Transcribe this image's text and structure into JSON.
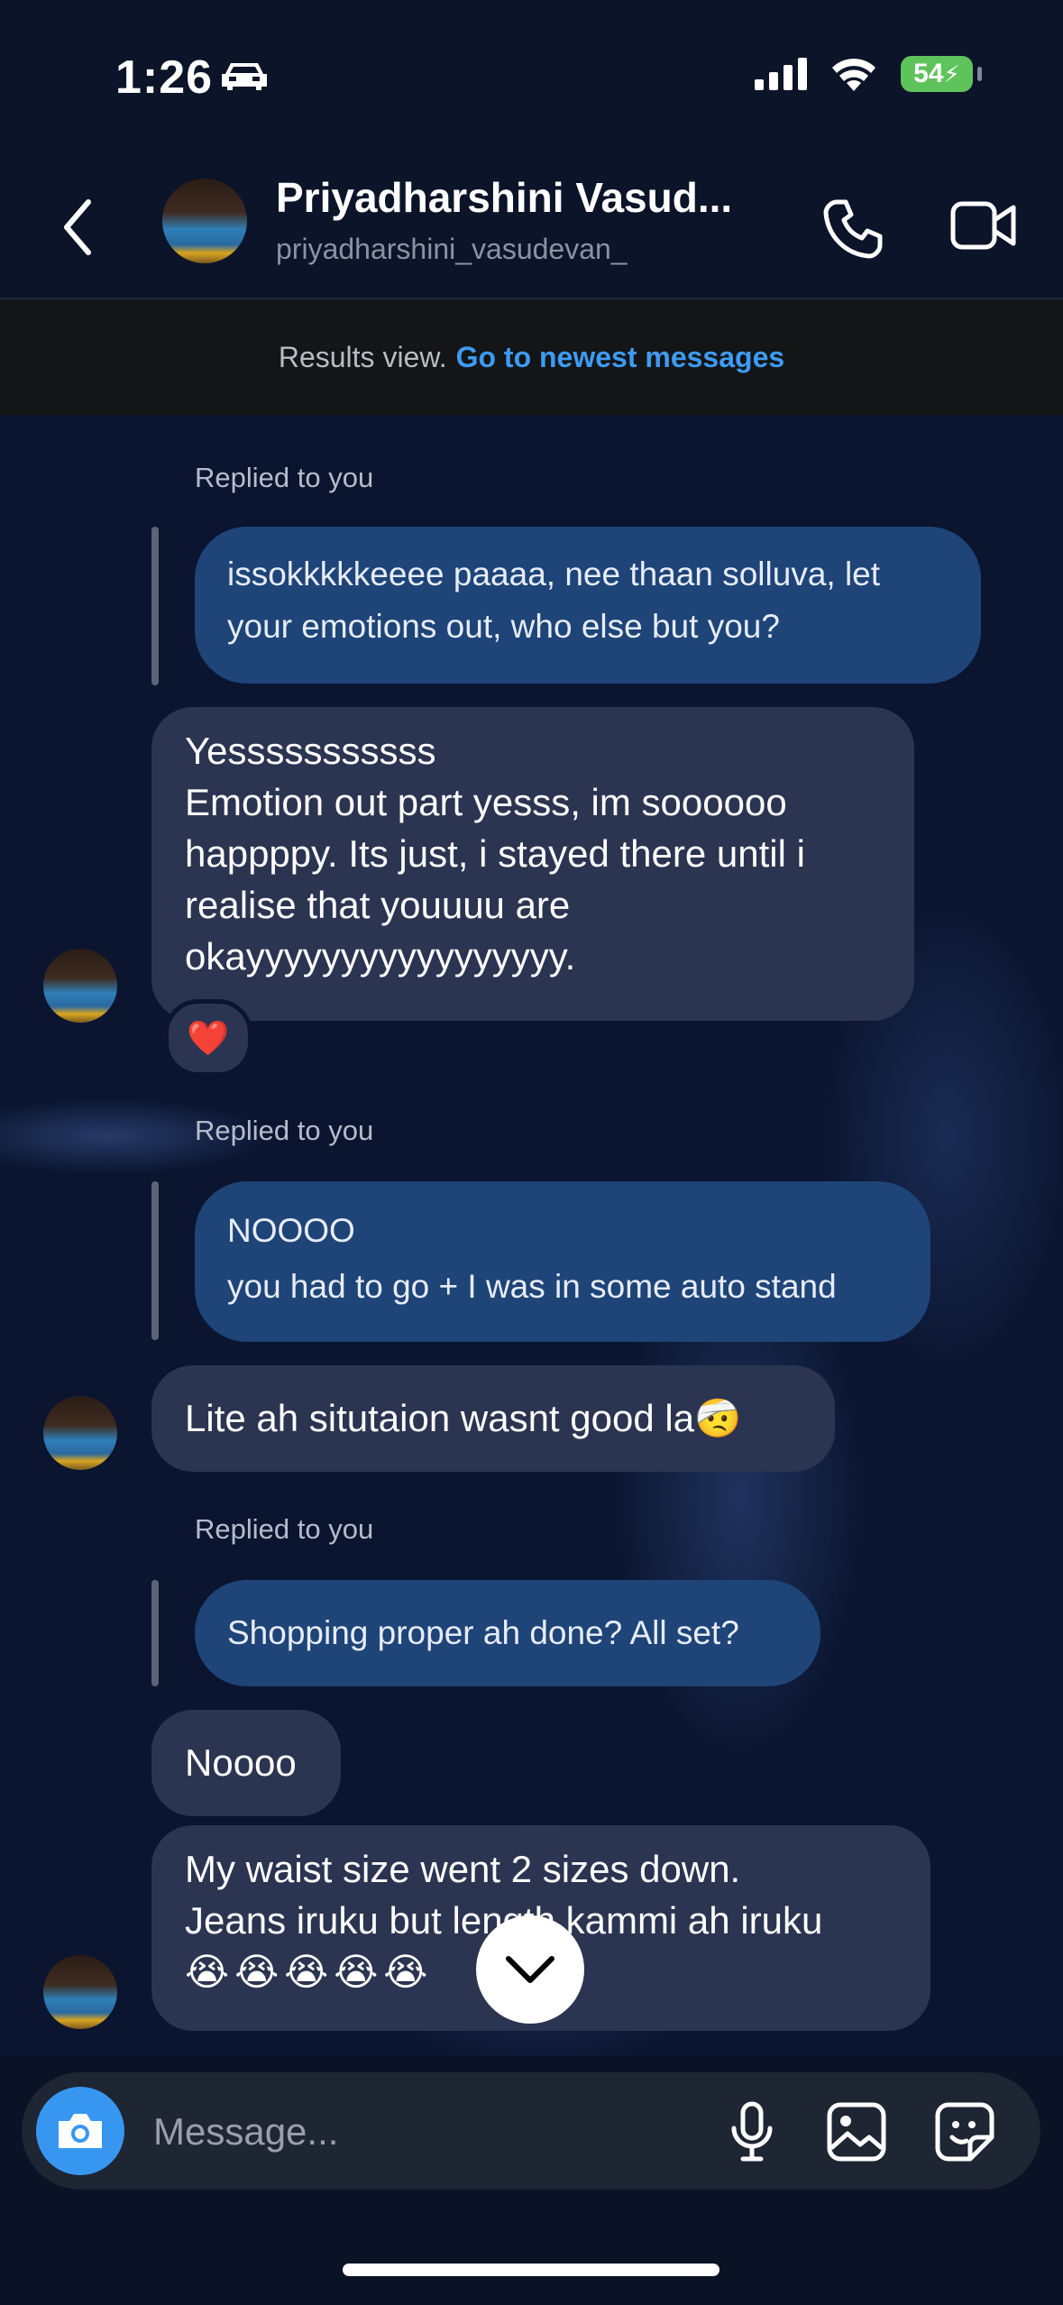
{
  "status": {
    "time": "1:26",
    "battery": "54"
  },
  "header": {
    "name": "Priyadharshini Vasud...",
    "handle": "priyadharshini_vasudevan_"
  },
  "results_bar": {
    "text": "Results view.",
    "link": "Go to newest messages"
  },
  "messages": [
    {
      "replied_label": "Replied to you",
      "lines": [
        "issokkkkkeeee paaaa, nee thaan solluva, let",
        "your emotions out, who else but you?"
      ]
    },
    {
      "lines": [
        "Yesssssssssss",
        "Emotion out part yesss, im soooooo",
        "happppy. Its just, i stayed there until i",
        "realise that youuuu are",
        "okayyyyyyyyyyyyyyyyy."
      ],
      "reaction": "❤️"
    },
    {
      "replied_label": "Replied to you",
      "lines": [
        "NOOOO",
        "you had to go + I was in some auto stand"
      ]
    },
    {
      "text": "Lite ah situtaion wasnt good la",
      "emoji": "🤕"
    },
    {
      "replied_label": "Replied to you",
      "text": "Shopping proper ah done? All set?"
    },
    {
      "text": "Noooo"
    },
    {
      "lines": [
        "My waist size went 2 sizes down.",
        "Jeans iruku but length kammi ah iruku"
      ],
      "emoji": "😭😭😭😭😭"
    }
  ],
  "composer": {
    "placeholder": "Message..."
  },
  "colors": {
    "accent": "#3797f0",
    "link": "#3d9bf4",
    "my_bubble": "#1e4478",
    "their_bubble": "#2b3450"
  },
  "icons": [
    "car-icon",
    "signal-icon",
    "wifi-icon",
    "battery-icon",
    "back-chevron-icon",
    "phone-icon",
    "video-icon",
    "heart-icon",
    "chevron-down-icon",
    "camera-icon",
    "microphone-icon",
    "image-icon",
    "sticker-icon"
  ]
}
